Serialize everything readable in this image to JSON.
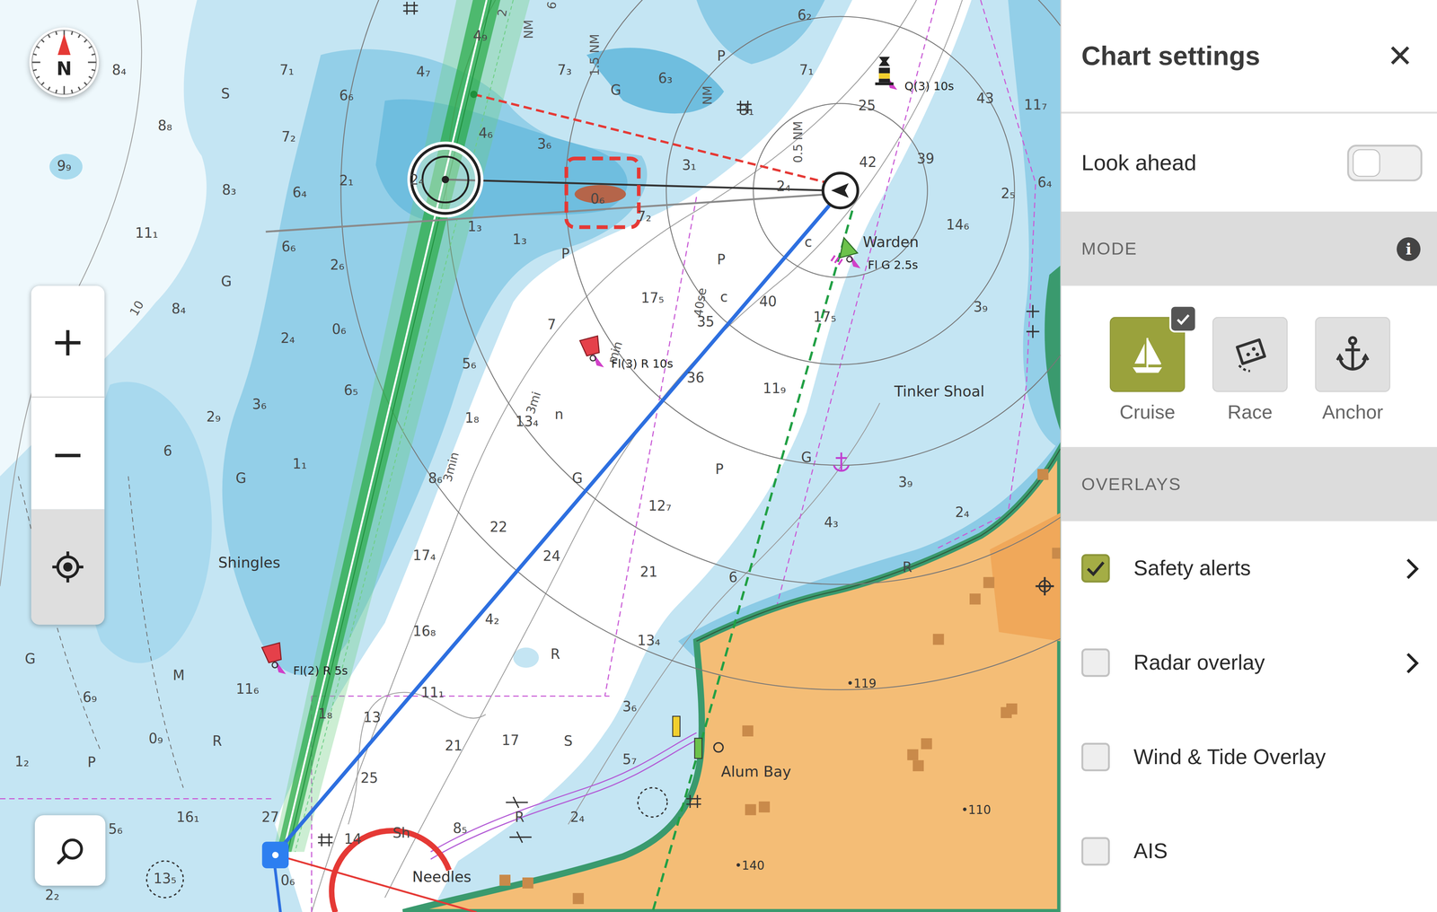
{
  "chart": {
    "compass": {
      "label": "N"
    },
    "zoom_in": "+",
    "zoom_out": "−",
    "soundings": [
      "8₄",
      "7₁",
      "6₆",
      "4₇",
      "4₉",
      "7₃",
      "6₃",
      "6₂",
      "7₁",
      "8₈",
      "7₂",
      "4₆",
      "3₆",
      "3₁",
      "3₁",
      "9₉",
      "8₃",
      "6₄",
      "2₁",
      "2₄",
      "0₆",
      "7₂",
      "1₃",
      "1₃",
      "2₄",
      "42",
      "39",
      "43",
      "25",
      "11₇",
      "2₅",
      "6₄",
      "14₆",
      "11₁",
      "6₆",
      "2₆",
      "8₄",
      "0₆",
      "2₄",
      "7",
      "17₅",
      "35",
      "40",
      "17₅",
      "3₉",
      "5₆",
      "3₆",
      "6₅",
      "36",
      "11₉",
      "2₉",
      "6",
      "1₈",
      "13₄",
      "1₁",
      "8₆",
      "3₉",
      "12₇",
      "22",
      "4₃",
      "2₄",
      "24",
      "21",
      "17₄",
      "6",
      "4₂",
      "16₈",
      "13₄",
      "11₆",
      "11₁",
      "1₈",
      "13",
      "3₆",
      "0₉",
      "6₉",
      "21",
      "17",
      "5₇",
      "25",
      "27",
      "16₁",
      "5₆",
      "8₅",
      "2₄",
      "14",
      "1₂",
      "13₅",
      "0₆",
      "2₂"
    ],
    "letters": [
      "S",
      "G",
      "P",
      "G",
      "P",
      "P",
      "G",
      "P",
      "G",
      "G",
      "R",
      "S",
      "M",
      "R",
      "P",
      "G",
      "R",
      "Sh",
      "R",
      "c",
      "n",
      "c"
    ],
    "annotations": [
      "1.5 NM",
      "NM",
      "0.5 NM",
      "NM",
      "2",
      "6",
      "3min",
      "3mi",
      "min",
      "40se",
      "10"
    ],
    "places": [
      "Shingles",
      "Tinker Shoal",
      "Alum Bay",
      "Needles",
      "Warden"
    ],
    "spot_heights": [
      "•119",
      "•110",
      "•140"
    ],
    "lights": [
      {
        "label": "Fl(3) R 10s",
        "color": "#e5404a"
      },
      {
        "label": "Fl(2) R 5s",
        "color": "#e5404a"
      },
      {
        "label": "Fl G 2.5s",
        "color": "#6cc24a"
      },
      {
        "label": "Q(3) 10s",
        "color": "#f2cf2e"
      }
    ]
  },
  "panel": {
    "title": "Chart settings",
    "close": "✕",
    "look_ahead": {
      "label": "Look ahead",
      "on": false
    },
    "mode_header": "MODE",
    "info": "i",
    "modes": [
      {
        "label": "Cruise",
        "selected": true
      },
      {
        "label": "Race",
        "selected": false
      },
      {
        "label": "Anchor",
        "selected": false
      }
    ],
    "overlays_header": "OVERLAYS",
    "overlays": [
      {
        "label": "Safety alerts",
        "checked": true,
        "kind": "submenu"
      },
      {
        "label": "Radar overlay",
        "checked": false,
        "kind": "submenu"
      },
      {
        "label": "Wind & Tide Overlay",
        "checked": false,
        "kind": "plain"
      },
      {
        "label": "AIS",
        "checked": false,
        "kind": "plain"
      }
    ]
  }
}
